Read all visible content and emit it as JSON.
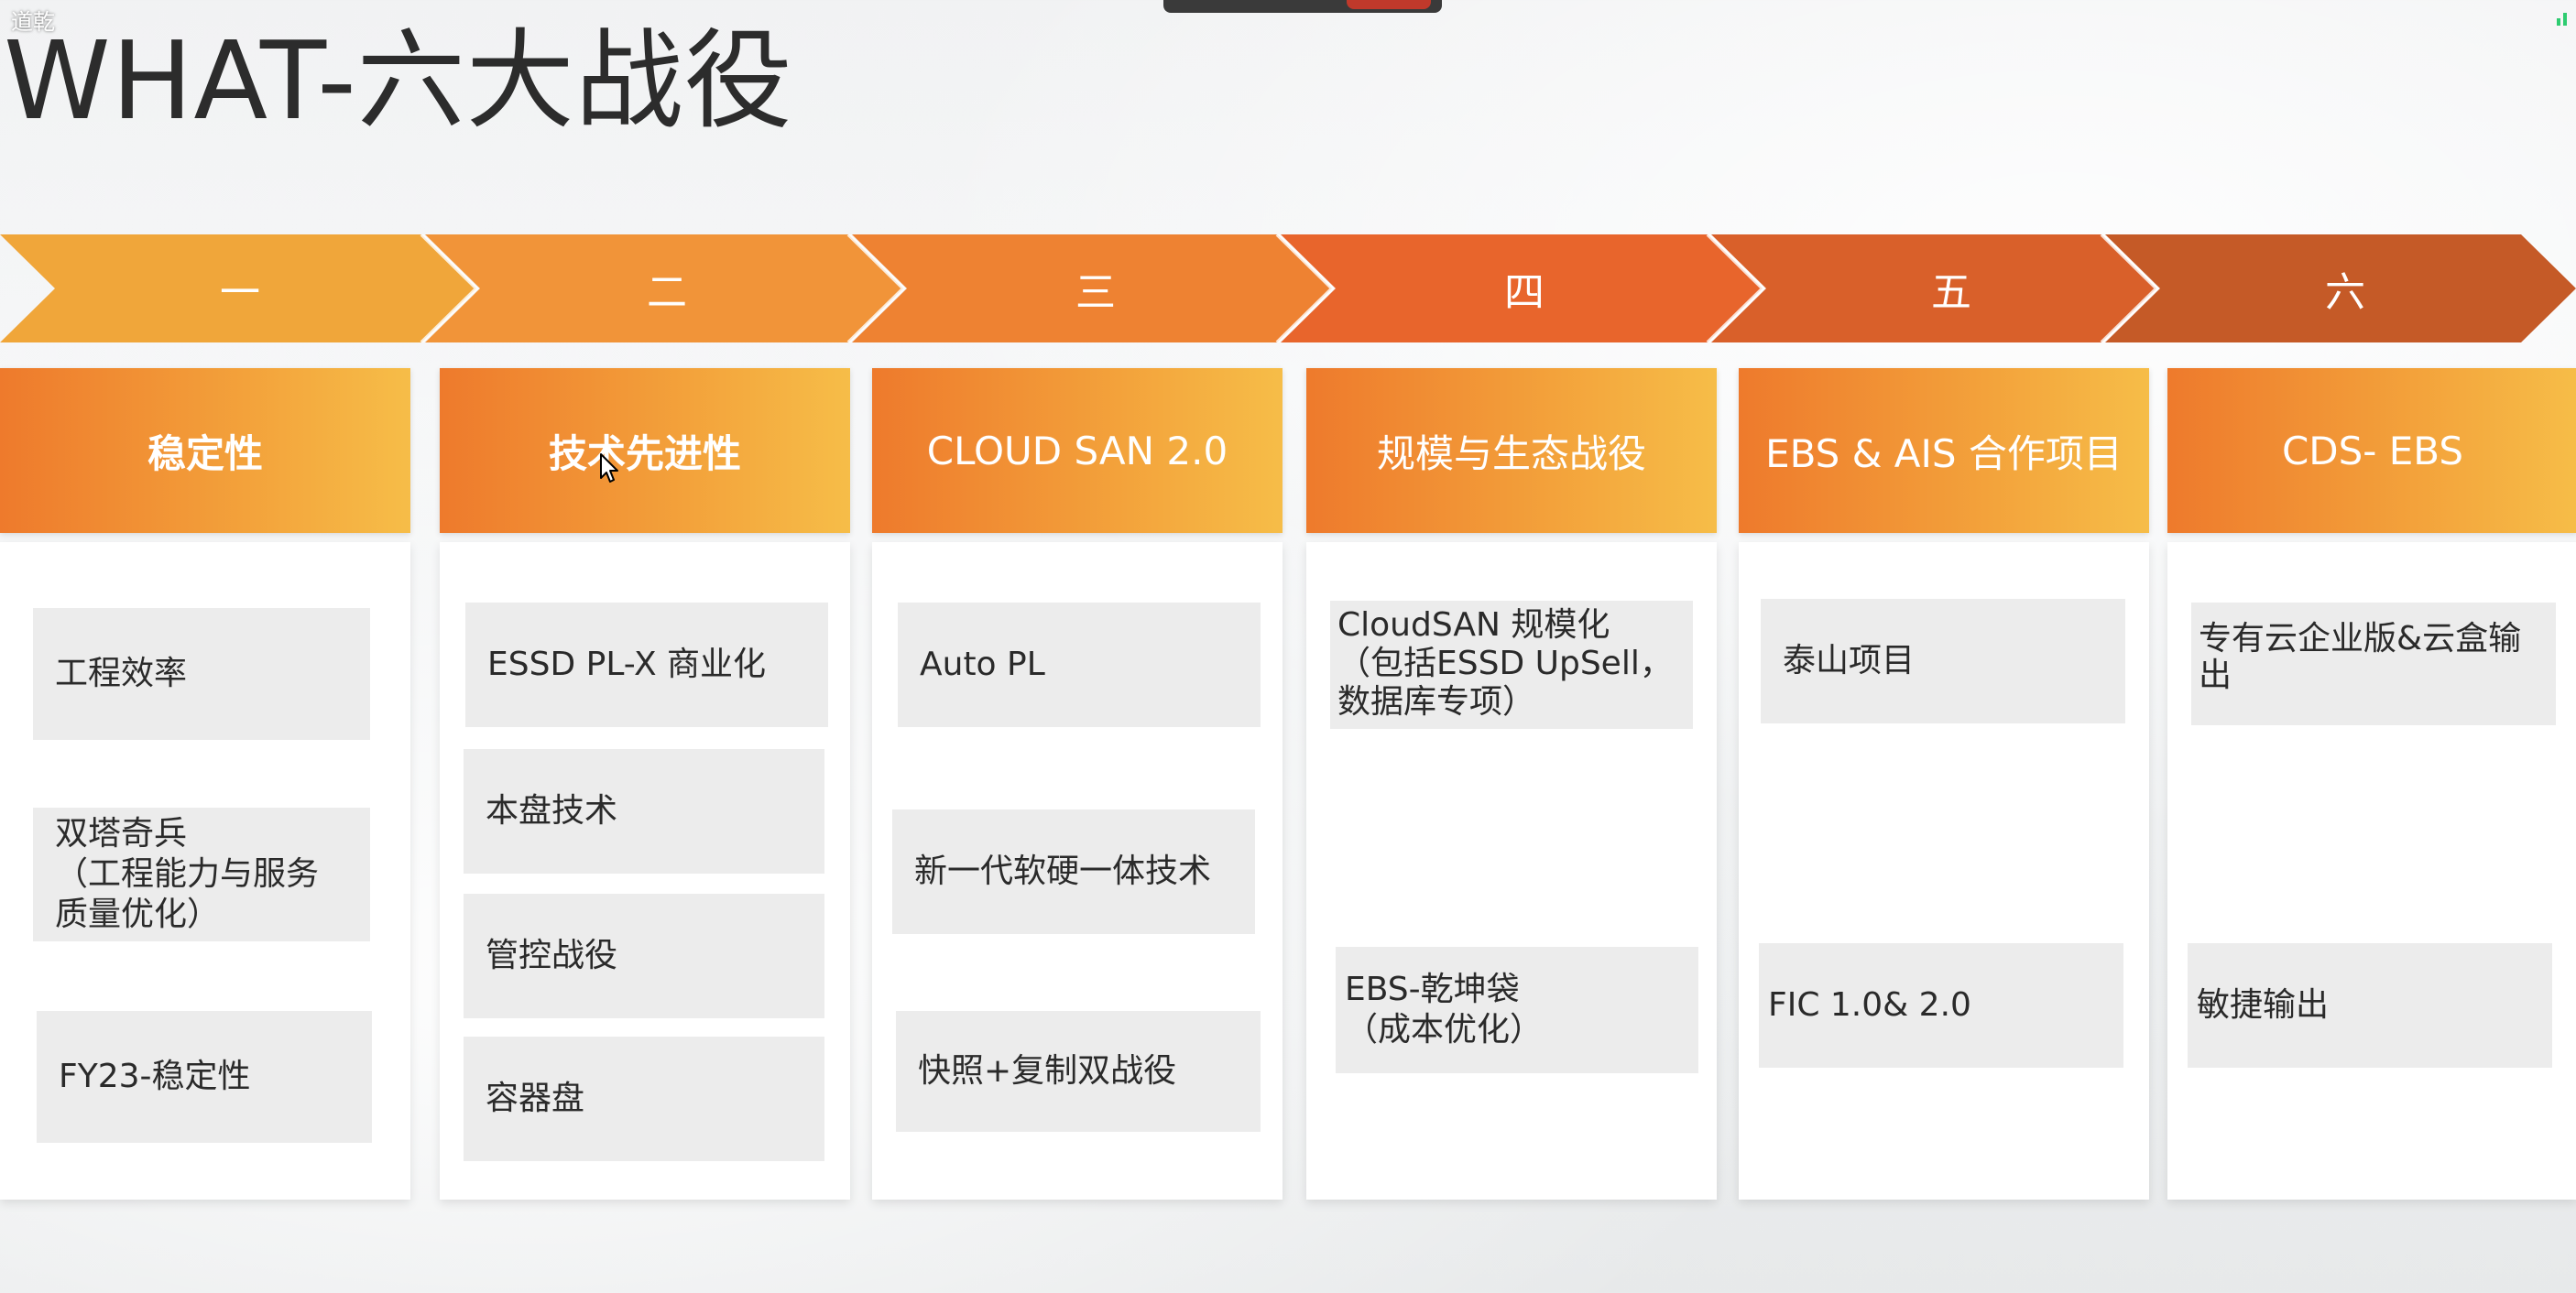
{
  "overlay": {
    "user_name": "道乾"
  },
  "slide": {
    "title": "WHAT-六大战役",
    "stages": [
      "一",
      "二",
      "三",
      "四",
      "五",
      "六"
    ],
    "columns": [
      {
        "header": "稳定性",
        "items": [
          "工程效率",
          "双塔奇兵\n（工程能力与服务质量优化）",
          "FY23-稳定性"
        ]
      },
      {
        "header": "技术先进性",
        "items": [
          "ESSD PL-X 商业化",
          "本盘技术",
          "管控战役",
          "容器盘"
        ]
      },
      {
        "header": "CLOUD SAN 2.0",
        "items": [
          "Auto PL",
          "新一代软硬一体技术",
          "快照+复制双战役"
        ]
      },
      {
        "header": "规模与生态战役",
        "items": [
          "CloudSAN 规模化\n（包括ESSD UpSell，数据库专项）",
          "EBS-乾坤袋\n（成本优化）"
        ]
      },
      {
        "header": "EBS & AIS 合作项目",
        "items": [
          "泰山项目",
          "FIC 1.0& 2.0"
        ]
      },
      {
        "header": "CDS- EBS",
        "items": [
          "专有云企业版&云盒输出",
          "敏捷输出"
        ]
      }
    ]
  },
  "colors": {
    "chevrons": [
      "#f0a63a",
      "#f19439",
      "#ee8232",
      "#e8652c",
      "#d9602a",
      "#c55a27"
    ],
    "header_gradient_start": "#ee7a2c",
    "header_gradient_end": "#f6bd48"
  },
  "icons": [
    "cursor-arrow-icon",
    "signal-bars-icon"
  ]
}
